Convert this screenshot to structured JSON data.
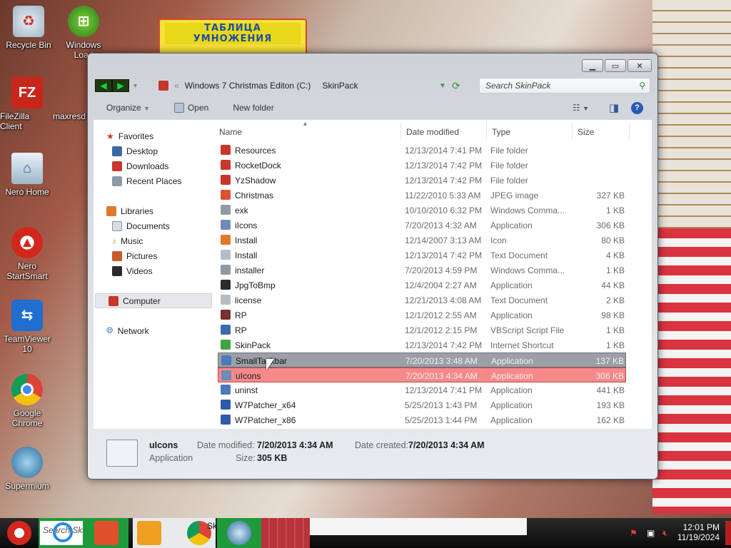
{
  "desktop": {
    "background_poster": "ТАБЛИЦА УМНОЖЕНИЯ",
    "icons": [
      {
        "label": "Recycle Bin"
      },
      {
        "label": "Windows Load"
      },
      {
        "label": "FileZilla Client"
      },
      {
        "label": "maxresd"
      },
      {
        "label": "Nero Home"
      },
      {
        "label": "Nero StartSmart"
      },
      {
        "label": "TeamViewer 10"
      },
      {
        "label": "Google Chrome"
      },
      {
        "label": "Supermium"
      }
    ]
  },
  "window": {
    "address": {
      "root": "Windows 7 Christmas Editon (C:)",
      "folder": "SkinPack"
    },
    "search_placeholder": "Search SkinPack",
    "toolbar": {
      "organize": "Organize",
      "open": "Open",
      "new_folder": "New folder"
    },
    "nav": {
      "favorites": "Favorites",
      "favorites_items": [
        "Desktop",
        "Downloads",
        "Recent Places"
      ],
      "libraries": "Libraries",
      "libraries_items": [
        "Documents",
        "Music",
        "Pictures",
        "Videos"
      ],
      "computer": "Computer",
      "network": "Network"
    },
    "columns": {
      "name": "Name",
      "date": "Date modified",
      "type": "Type",
      "size": "Size"
    },
    "files": [
      {
        "name": "Resources",
        "date": "12/13/2014 7:41 PM",
        "type": "File folder",
        "size": "",
        "color": "#c8372a"
      },
      {
        "name": "RocketDock",
        "date": "12/13/2014 7:42 PM",
        "type": "File folder",
        "size": "",
        "color": "#c8372a"
      },
      {
        "name": "YzShadow",
        "date": "12/13/2014 7:42 PM",
        "type": "File folder",
        "size": "",
        "color": "#c8372a"
      },
      {
        "name": "Christmas",
        "date": "11/22/2010 5:33 AM",
        "type": "JPEG image",
        "size": "327 KB",
        "color": "#d9532f"
      },
      {
        "name": "exk",
        "date": "10/10/2010 6:32 PM",
        "type": "Windows Comma...",
        "size": "1 KB",
        "color": "#8f9aa6"
      },
      {
        "name": "iIcons",
        "date": "7/20/2013 4:32 AM",
        "type": "Application",
        "size": "306 KB",
        "color": "#6f8cb8"
      },
      {
        "name": "Install",
        "date": "12/14/2007 3:13 AM",
        "type": "Icon",
        "size": "80 KB",
        "color": "#e07a2a"
      },
      {
        "name": "Install",
        "date": "12/13/2014 7:42 PM",
        "type": "Text Document",
        "size": "4 KB",
        "color": "#b5bcc4"
      },
      {
        "name": "installer",
        "date": "7/20/2013 4:59 PM",
        "type": "Windows Comma...",
        "size": "1 KB",
        "color": "#8f9aa6"
      },
      {
        "name": "JpgToBmp",
        "date": "12/4/2004 2:27 AM",
        "type": "Application",
        "size": "44 KB",
        "color": "#2b2b2b"
      },
      {
        "name": "license",
        "date": "12/21/2013 4:08 AM",
        "type": "Text Document",
        "size": "2 KB",
        "color": "#b5bcc4"
      },
      {
        "name": "RP",
        "date": "12/1/2012 2:55 AM",
        "type": "Application",
        "size": "98 KB",
        "color": "#7a3030"
      },
      {
        "name": "RP",
        "date": "12/1/2012 2:15 PM",
        "type": "VBScript Script File",
        "size": "1 KB",
        "color": "#3a6ab0"
      },
      {
        "name": "SkinPack",
        "date": "12/13/2014 7:42 PM",
        "type": "Internet Shortcut",
        "size": "1 KB",
        "color": "#3fa33f"
      },
      {
        "name": "SmallTaskbar",
        "date": "7/20/2013 3:48 AM",
        "type": "Application",
        "size": "137 KB",
        "color": "#4a7ab8",
        "highlight": "gray"
      },
      {
        "name": "uIcons",
        "date": "7/20/2013 4:34 AM",
        "type": "Application",
        "size": "306 KB",
        "color": "#6f8cb8",
        "highlight": "red"
      },
      {
        "name": "uninst",
        "date": "12/13/2014 7:41 PM",
        "type": "Application",
        "size": "441 KB",
        "color": "#4a7ab8"
      },
      {
        "name": "W7Patcher_x64",
        "date": "5/25/2013 1:43 PM",
        "type": "Application",
        "size": "193 KB",
        "color": "#2f5aa8"
      },
      {
        "name": "W7Patcher_x86",
        "date": "5/25/2013 1:44 PM",
        "type": "Application",
        "size": "162 KB",
        "color": "#2f5aa8"
      }
    ],
    "details": {
      "name": "uIcons",
      "kind": "Application",
      "date_modified_label": "Date modified:",
      "date_modified": "7/20/2013 4:34 AM",
      "date_created_label": "Date created:",
      "date_created": "7/20/2013 4:34 AM",
      "size_label": "Size:",
      "size": "305 KB"
    }
  },
  "taskbar": {
    "search_text": "Search Skin",
    "chrome_text": "Ski",
    "time": "12:01 PM",
    "date": "11/19/2024"
  }
}
